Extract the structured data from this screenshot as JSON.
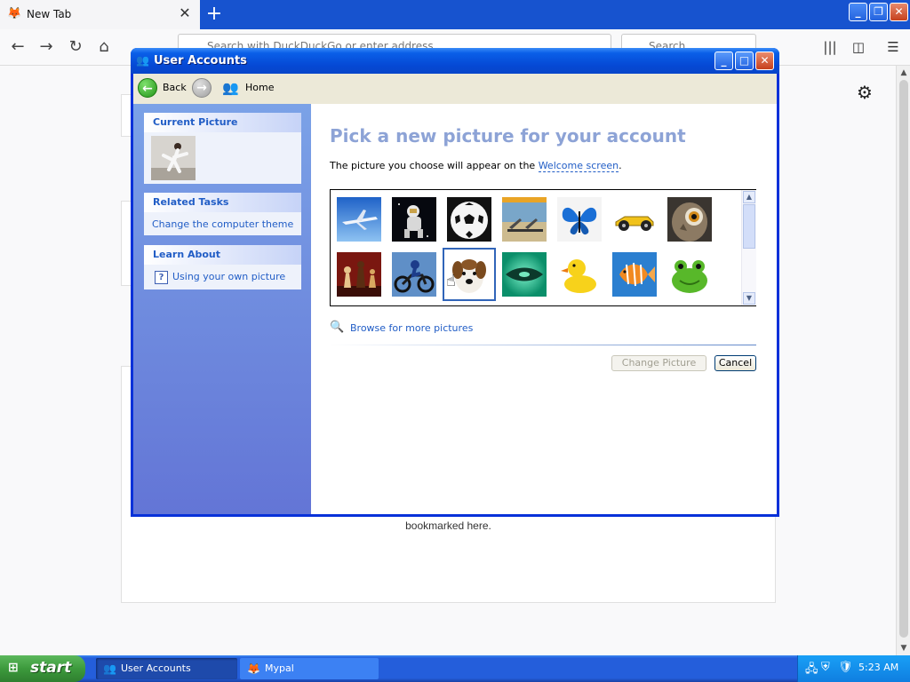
{
  "browser": {
    "tab_title": "New Tab",
    "url_placeholder": "Search with DuckDuckGo or enter address",
    "search_placeholder": "Search",
    "page_text": "bookmarked here."
  },
  "dialog": {
    "title": "User Accounts",
    "toolbar": {
      "back": "Back",
      "home": "Home"
    },
    "sidebar": {
      "current_picture": {
        "heading": "Current Picture"
      },
      "related_tasks": {
        "heading": "Related Tasks",
        "items": [
          "Change the computer theme"
        ]
      },
      "learn_about": {
        "heading": "Learn About",
        "items": [
          "Using your own picture"
        ]
      }
    },
    "main": {
      "heading": "Pick a new picture for your account",
      "desc_prefix": "The picture you choose will appear on the ",
      "desc_link": "Welcome screen",
      "desc_suffix": ".",
      "pictures": [
        "airplane",
        "astronaut",
        "soccer ball",
        "beach chairs",
        "butterfly",
        "car",
        "owl",
        "chess",
        "dirt bike",
        "dog",
        "fish",
        "duck",
        "fish",
        "frog"
      ],
      "selected_picture": "dog",
      "browse_link": "Browse for more pictures",
      "change_button": "Change Picture",
      "cancel_button": "Cancel"
    }
  },
  "taskbar": {
    "start": "start",
    "items": [
      "User Accounts",
      "Mypal"
    ],
    "clock": "5:23 AM"
  }
}
